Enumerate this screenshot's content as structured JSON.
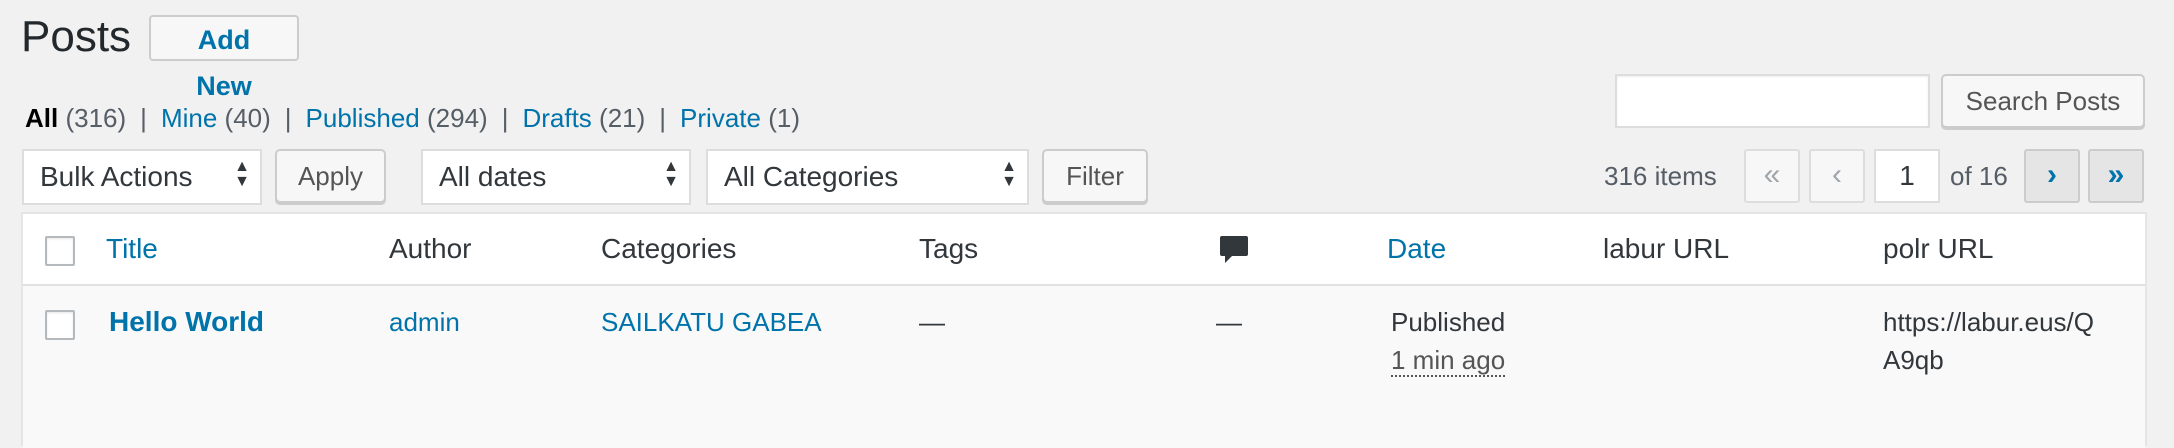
{
  "header": {
    "title": "Posts",
    "add_new_label": "Add New"
  },
  "views": [
    {
      "label": "All",
      "count": "(316)",
      "current": true
    },
    {
      "label": "Mine",
      "count": "(40)",
      "current": false
    },
    {
      "label": "Published",
      "count": "(294)",
      "current": false
    },
    {
      "label": "Drafts",
      "count": "(21)",
      "current": false
    },
    {
      "label": "Private",
      "count": "(1)",
      "current": false
    }
  ],
  "views_separator": "|",
  "search": {
    "value": "",
    "button_label": "Search Posts"
  },
  "filters": {
    "bulk_action": "Bulk Actions",
    "apply_label": "Apply",
    "date": "All dates",
    "category": "All Categories",
    "filter_label": "Filter"
  },
  "pagination": {
    "items": "316 items",
    "first": "«",
    "prev": "‹",
    "current_page": "1",
    "of_pages": "of 16",
    "next": "›",
    "last": "»"
  },
  "table": {
    "columns": {
      "title": "Title",
      "author": "Author",
      "categories": "Categories",
      "tags": "Tags",
      "comments_icon": "comment-bubble-icon",
      "date": "Date",
      "labur_url": "labur URL",
      "polr_url": "polr URL"
    },
    "rows": [
      {
        "title": "Hello World",
        "author": "admin",
        "categories": "SAILKATU GABEA",
        "tags": "—",
        "comments": "—",
        "date_status": "Published",
        "date_ago": "1 min ago",
        "labur_url": "",
        "polr_url_line1": "https://labur.eus/Q",
        "polr_url_line2": "A9qb"
      }
    ]
  },
  "colors": {
    "link": "#0073aa",
    "background": "#f1f1f1",
    "text": "#23282d"
  }
}
